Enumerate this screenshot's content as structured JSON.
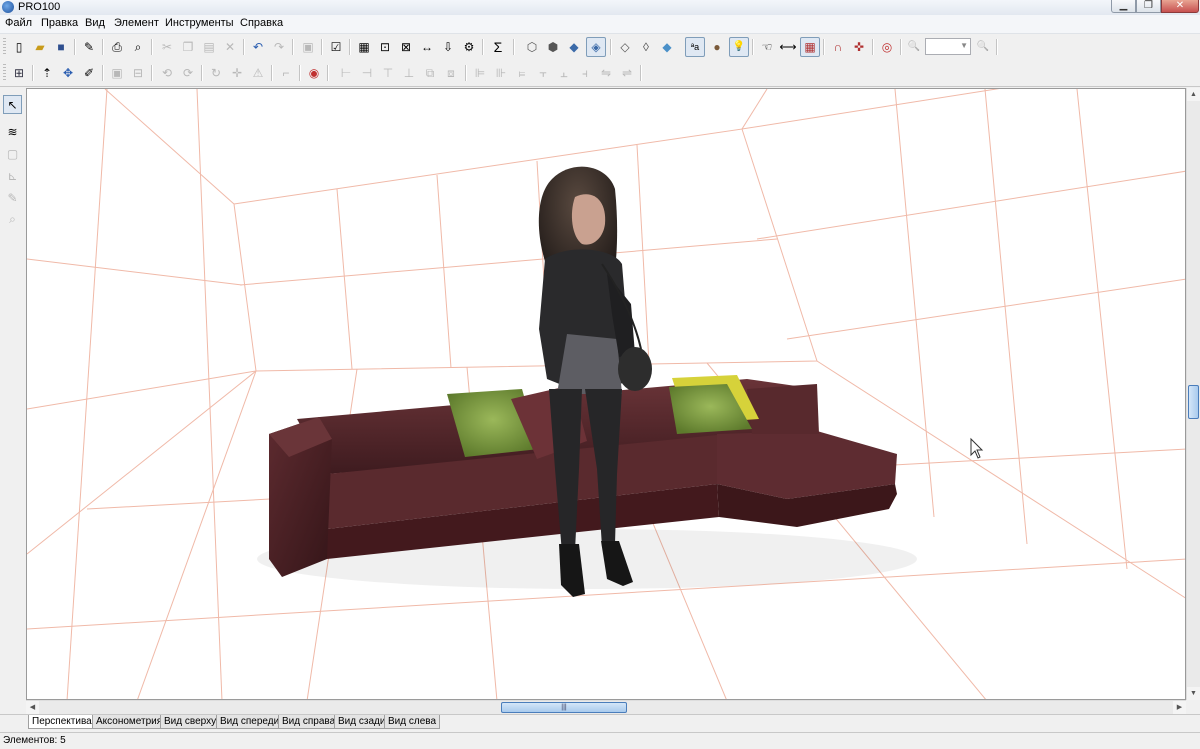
{
  "window": {
    "title": "PRO100"
  },
  "menu": {
    "items": [
      "Файл",
      "Правка",
      "Вид",
      "Элемент",
      "Инструменты",
      "Справка"
    ]
  },
  "toolbar1": {
    "buttons": [
      {
        "icon": "new-file-icon",
        "glyph": "▯"
      },
      {
        "icon": "open-folder-icon",
        "glyph": "▰"
      },
      {
        "icon": "save-icon",
        "glyph": "■"
      },
      {
        "icon": "properties-icon",
        "glyph": "✎"
      },
      {
        "icon": "print-icon",
        "glyph": "⎙"
      },
      {
        "icon": "print-preview-icon",
        "glyph": "⌕"
      },
      {
        "icon": "cut-icon",
        "glyph": "✂"
      },
      {
        "icon": "copy-icon",
        "glyph": "❐"
      },
      {
        "icon": "paste-icon",
        "glyph": "▤"
      },
      {
        "icon": "delete-icon",
        "glyph": "✕"
      },
      {
        "icon": "undo-icon",
        "glyph": "↶"
      },
      {
        "icon": "redo-icon",
        "glyph": "↷"
      },
      {
        "icon": "group-icon",
        "glyph": "▣"
      },
      {
        "icon": "checklist-icon",
        "glyph": "☑"
      },
      {
        "icon": "report-icon",
        "glyph": "▦"
      },
      {
        "icon": "search-doc-icon",
        "glyph": "⊡"
      },
      {
        "icon": "zoom-doc-icon",
        "glyph": "⊠"
      },
      {
        "icon": "dimension-icon",
        "glyph": "↔"
      },
      {
        "icon": "export-icon",
        "glyph": "⇩"
      },
      {
        "icon": "settings-doc-icon",
        "glyph": "⚙"
      },
      {
        "icon": "sum-icon",
        "glyph": "Σ"
      },
      {
        "icon": "wireframe-view-icon",
        "glyph": "⬡"
      },
      {
        "icon": "hidden-lines-view-icon",
        "glyph": "⬢"
      },
      {
        "icon": "shaded-view-icon",
        "glyph": "◆"
      },
      {
        "icon": "textured-view-icon",
        "glyph": "◈"
      },
      {
        "icon": "box-outline-icon",
        "glyph": "◇"
      },
      {
        "icon": "box-edges-icon",
        "glyph": "◊"
      },
      {
        "icon": "box-blue-icon",
        "glyph": "◆"
      },
      {
        "icon": "text-labels-icon",
        "glyph": "ªa"
      },
      {
        "icon": "materials-icon",
        "glyph": "●"
      },
      {
        "icon": "light-bulb-icon",
        "glyph": "💡"
      },
      {
        "icon": "hand-pointer-icon",
        "glyph": "☜"
      },
      {
        "icon": "ruler-icon",
        "glyph": "⟷"
      },
      {
        "icon": "grid-icon",
        "glyph": "▦"
      },
      {
        "icon": "magnet-icon",
        "glyph": "∩"
      },
      {
        "icon": "collision-icon",
        "glyph": "✜"
      },
      {
        "icon": "target-icon",
        "glyph": "◎"
      },
      {
        "icon": "zoom-out-icon",
        "glyph": "🔍"
      },
      {
        "icon": "zoom-in-icon",
        "glyph": "🔍"
      }
    ]
  },
  "toolbar2": {
    "buttons": [
      {
        "icon": "select-all-icon",
        "glyph": "⊞"
      },
      {
        "icon": "move-up-icon",
        "glyph": "⇡"
      },
      {
        "icon": "move-icon",
        "glyph": "✥"
      },
      {
        "icon": "edit-shape-icon",
        "glyph": "✐"
      },
      {
        "icon": "align-group-icon",
        "glyph": "▣"
      },
      {
        "icon": "ungroup-icon",
        "glyph": "⊟"
      },
      {
        "icon": "rotate-left-icon",
        "glyph": "⟲"
      },
      {
        "icon": "rotate-right-icon",
        "glyph": "⟳"
      },
      {
        "icon": "rotate-icon",
        "glyph": "↻"
      },
      {
        "icon": "cross-move-icon",
        "glyph": "✛"
      },
      {
        "icon": "warning-icon",
        "glyph": "⚠"
      },
      {
        "icon": "corner-icon",
        "glyph": "⌐"
      },
      {
        "icon": "lifebuoy-icon",
        "glyph": "◉"
      },
      {
        "icon": "align-left-icon",
        "glyph": "⊢"
      },
      {
        "icon": "align-center-icon",
        "glyph": "⊣"
      },
      {
        "icon": "align-top-icon",
        "glyph": "⊤"
      },
      {
        "icon": "align-middle-icon",
        "glyph": "⊥"
      },
      {
        "icon": "distribute-icon",
        "glyph": "⧉"
      },
      {
        "icon": "arrange-icon",
        "glyph": "⧈"
      },
      {
        "icon": "stack-left-icon",
        "glyph": "⊫"
      },
      {
        "icon": "stack-center-icon",
        "glyph": "⊪"
      },
      {
        "icon": "stack-right-icon",
        "glyph": "⫢"
      },
      {
        "icon": "stack-top-icon",
        "glyph": "⫟"
      },
      {
        "icon": "stack-bottom-icon",
        "glyph": "⫠"
      },
      {
        "icon": "stack-middle-icon",
        "glyph": "⫞"
      },
      {
        "icon": "flip-icon",
        "glyph": "⇋"
      },
      {
        "icon": "mirror-icon",
        "glyph": "⇌"
      }
    ]
  },
  "left_toolbar": {
    "buttons": [
      {
        "icon": "select-arrow-icon",
        "glyph": "↖"
      },
      {
        "icon": "walls-icon",
        "glyph": "≋"
      },
      {
        "icon": "box-icon",
        "glyph": "▢"
      },
      {
        "icon": "measure-icon",
        "glyph": "⊾"
      },
      {
        "icon": "annotation-icon",
        "glyph": "✎"
      },
      {
        "icon": "zoom-tool-icon",
        "glyph": "⌕"
      }
    ]
  },
  "scene": {
    "description_hidden": ""
  },
  "tabs": [
    {
      "label": "Перспектива",
      "active": true
    },
    {
      "label": "Аксонометрия",
      "active": false
    },
    {
      "label": "Вид сверху",
      "active": false
    },
    {
      "label": "Вид спереди",
      "active": false
    },
    {
      "label": "Вид справа",
      "active": false
    },
    {
      "label": "Вид сзади",
      "active": false
    },
    {
      "label": "Вид слева",
      "active": false
    }
  ],
  "status": {
    "elements": "Элементов: 5"
  }
}
